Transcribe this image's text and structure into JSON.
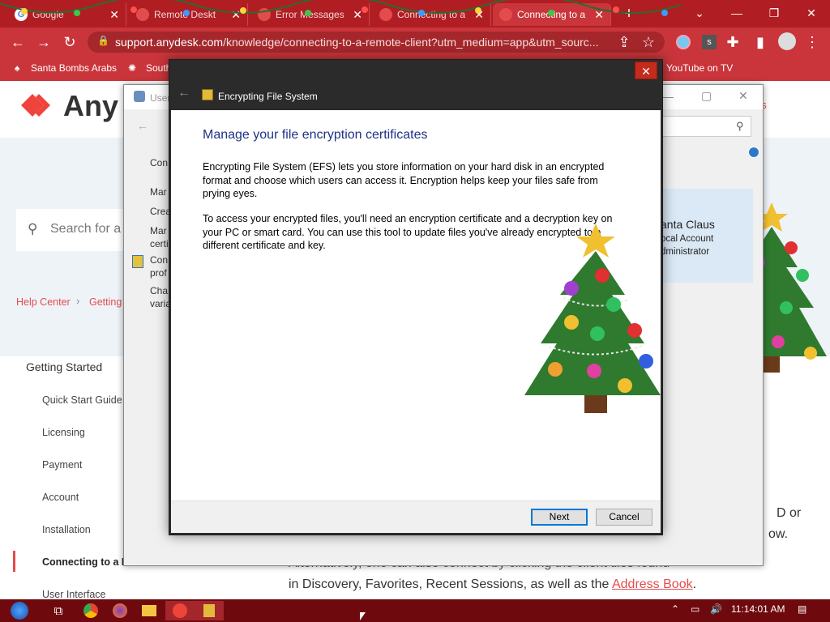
{
  "browser": {
    "tabs": [
      {
        "title": "Google",
        "active": false
      },
      {
        "title": "Remote Deskt",
        "active": false
      },
      {
        "title": "Error Messages",
        "active": false
      },
      {
        "title": "Connecting to a",
        "active": false
      },
      {
        "title": "Connecting to a",
        "active": true
      }
    ],
    "new_tab": "+",
    "url_host": "support.anydesk.com",
    "url_path": "/knowledge/connecting-to-a-remote-client?utm_medium=app&utm_sourc...",
    "bookmarks": [
      "Santa Bombs Arabs",
      "South",
      "YouTube on TV"
    ]
  },
  "page": {
    "logo": "Any",
    "search_placeholder": "Search for a",
    "breadcrumb": [
      "Help Center",
      "Getting"
    ],
    "sidebar_title": "Getting Started",
    "sidebar_items": [
      "Quick Start Guide",
      "Licensing",
      "Payment",
      "Account",
      "Installation",
      "Connecting to a R",
      "User Interface"
    ],
    "content_line1": "Alternatively, one can also connect by clicking the client tiles found",
    "content_line2_prefix": "in Discovery, Favorites, Recent Sessions, as well as the ",
    "content_link": "Address Book",
    "content_line2_suffix": ".",
    "right_fragment1": "D or",
    "right_fragment2": "ow.",
    "right_top": "us"
  },
  "background_window": {
    "title": "User",
    "left_items": [
      "Con",
      "Mar",
      "Crea",
      "Mar\ncerti",
      "Con\nprof",
      "Cha\nvaria"
    ],
    "user_name": "anta Claus",
    "user_type": "ocal Account",
    "user_role": "dministrator"
  },
  "dialog": {
    "title": "Encrypting File System",
    "heading": "Manage your file encryption certificates",
    "para1": "Encrypting File System (EFS) lets you store information on your hard disk in an encrypted format and choose which users can access it. Encryption helps keep your files safe from prying eyes.",
    "para2": "To access your encrypted files, you'll need an encryption certificate and a decryption key on your PC or smart card. You can use this tool to update files you've already encrypted to a different certificate and key.",
    "next": "Next",
    "cancel": "Cancel"
  },
  "taskbar": {
    "clock": "11:14:01 AM"
  },
  "colors": {
    "chrome_red": "#c9353a",
    "tab_bar": "#b01e23",
    "dialog_heading": "#1e3287",
    "taskbar": "#6e0a0e"
  }
}
